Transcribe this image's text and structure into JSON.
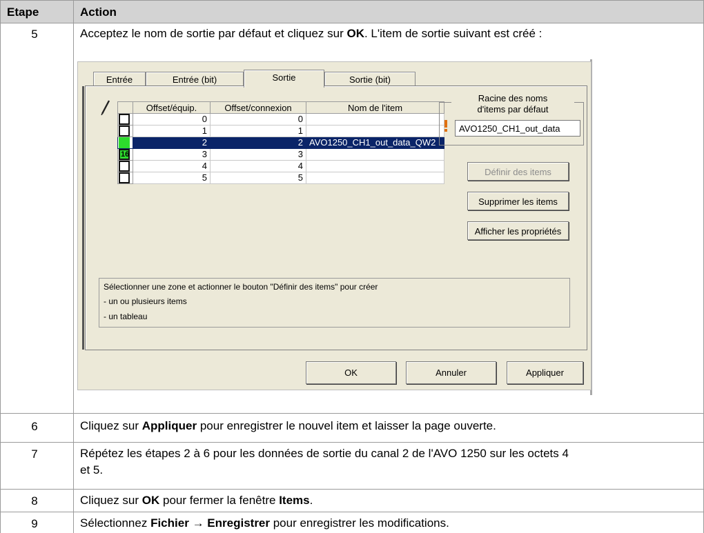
{
  "header": {
    "col_step": "Etape",
    "col_action": "Action"
  },
  "rows": [
    {
      "step": "5",
      "parts": [
        "Acceptez le nom de sortie par défaut et cliquez sur ",
        "OK",
        ". L'item de sortie suivant est créé :"
      ]
    },
    {
      "step": "6",
      "parts": [
        "Cliquez sur ",
        "Appliquer",
        " pour enregistrer le nouvel item et laisser la page ouverte."
      ]
    },
    {
      "step": "7",
      "line1": "Répétez les étapes 2 à 6 pour les données de sortie du canal 2 de l'AVO 1250 sur les octets 4",
      "line2": "et 5."
    },
    {
      "step": "8",
      "parts": [
        "Cliquez sur ",
        "OK",
        " pour fermer la fenêtre ",
        "Items",
        "."
      ]
    },
    {
      "step": "9",
      "parts": [
        "Sélectionnez ",
        "Fichier",
        " ",
        "→",
        " ",
        "Enregistrer",
        " pour enregistrer les modifications."
      ]
    }
  ],
  "dialog": {
    "tabs": [
      "Entrée",
      "Entrée (bit)",
      "Sortie",
      "Sortie (bit)"
    ],
    "active_tab": "Sortie",
    "columns": [
      "Offset/équip.",
      "Offset/connexion",
      "Nom de l'item"
    ],
    "grid_rows": [
      {
        "offset_equip": "0",
        "offset_conn": "0",
        "name": "",
        "state": "empty"
      },
      {
        "offset_equip": "1",
        "offset_conn": "1",
        "name": "",
        "state": "empty"
      },
      {
        "offset_equip": "2",
        "offset_conn": "2",
        "name": "AVO1250_CH1_out_data_QW2",
        "state": "green"
      },
      {
        "offset_equip": "3",
        "offset_conn": "3",
        "name": "",
        "state": "green16",
        "badge": "16"
      },
      {
        "offset_equip": "4",
        "offset_conn": "4",
        "name": "",
        "state": "empty"
      },
      {
        "offset_equip": "5",
        "offset_conn": "5",
        "name": "",
        "state": "empty"
      }
    ],
    "root_title_line1": "Racine des noms",
    "root_title_line2": "d'items par défaut",
    "root_value": "AVO1250_CH1_out_data",
    "btn_define": "Définir des items",
    "btn_delete": "Supprimer les items",
    "btn_props": "Afficher les propriétés",
    "info_line1": "Sélectionner une zone et actionner le bouton \"Définir des items\" pour créer",
    "info_line2": "- un ou plusieurs items",
    "info_line3": "- un tableau",
    "btn_ok": "OK",
    "btn_cancel": "Annuler",
    "btn_apply": "Appliquer"
  }
}
